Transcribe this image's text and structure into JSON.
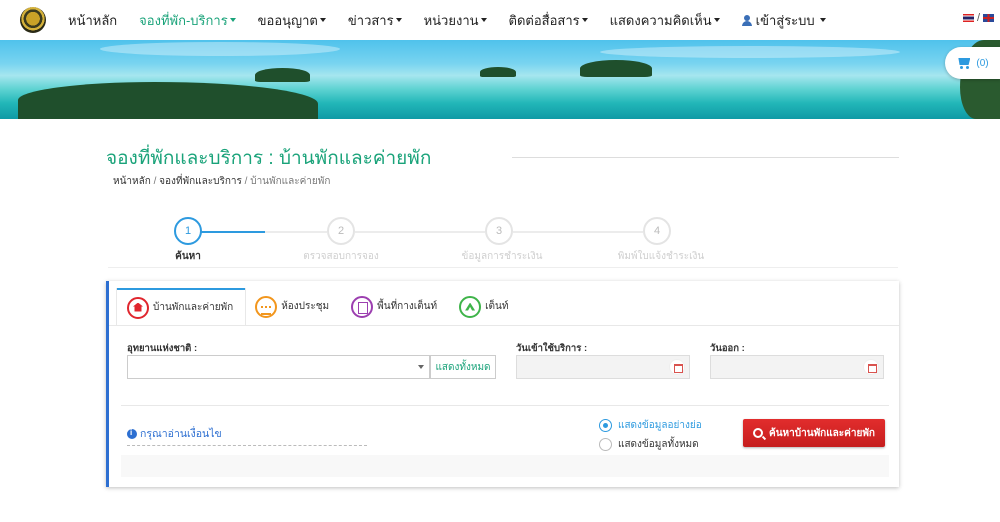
{
  "nav": {
    "items": [
      {
        "label": "หน้าหลัก",
        "dropdown": false,
        "active": false
      },
      {
        "label": "จองที่พัก-บริการ",
        "dropdown": true,
        "active": true
      },
      {
        "label": "ขออนุญาต",
        "dropdown": true,
        "active": false
      },
      {
        "label": "ข่าวสาร",
        "dropdown": true,
        "active": false
      },
      {
        "label": "หน่วยงาน",
        "dropdown": true,
        "active": false
      },
      {
        "label": "ติดต่อสื่อสาร",
        "dropdown": true,
        "active": false
      },
      {
        "label": "แสดงความคิดเห็น",
        "dropdown": true,
        "active": false
      }
    ],
    "login_label": "เข้าสู่ระบบ",
    "lang_separator": "/",
    "accent_color": "#1aa37a"
  },
  "cart": {
    "count": "(0)"
  },
  "page": {
    "title": "จองที่พักและบริการ : บ้านพักและค่ายพัก",
    "breadcrumb": {
      "home": "หน้าหลัก",
      "sep1": " / ",
      "section": "จองที่พักและบริการ",
      "sep2": " / ",
      "current": "บ้านพักและค่ายพัก"
    }
  },
  "steps": [
    {
      "number": "1",
      "label": "ค้นหา",
      "active": true
    },
    {
      "number": "2",
      "label": "ตรวจสอบการจอง",
      "active": false
    },
    {
      "number": "3",
      "label": "ข้อมูลการชำระเงิน",
      "active": false
    },
    {
      "number": "4",
      "label": "พิมพ์ใบแจ้งชำระเงิน",
      "active": false
    }
  ],
  "tabs": [
    {
      "label": "บ้านพักและค่ายพัก",
      "icon": "house-icon",
      "active": true
    },
    {
      "label": "ห้องประชุม",
      "icon": "meeting-icon",
      "active": false
    },
    {
      "label": "พื้นที่กางเต็นท์",
      "icon": "camp-area-icon",
      "active": false
    },
    {
      "label": "เต็นท์",
      "icon": "tent-icon",
      "active": false
    }
  ],
  "form": {
    "park_label": "อุทยานแห่งชาติ :",
    "park_value": "",
    "show_all_button": "แสดงทั้งหมด",
    "checkin_label": "วันเข้าใช้บริการ :",
    "checkin_value": "",
    "checkout_label": "วันออก :",
    "checkout_value": "",
    "read_notice": "กรุณาอ่านเงื่อนไข",
    "radio_summary": "แสดงข้อมูลอย่างย่อ",
    "radio_all": "แสดงข้อมูลทั้งหมด",
    "radio_selected": "summary",
    "search_button": "ค้นหาบ้านพักและค่ายพัก"
  },
  "colors": {
    "primary": "#2d9adf",
    "green": "#1aa37a",
    "danger": "#d9232b",
    "panel_accent": "#2d6fd1"
  }
}
